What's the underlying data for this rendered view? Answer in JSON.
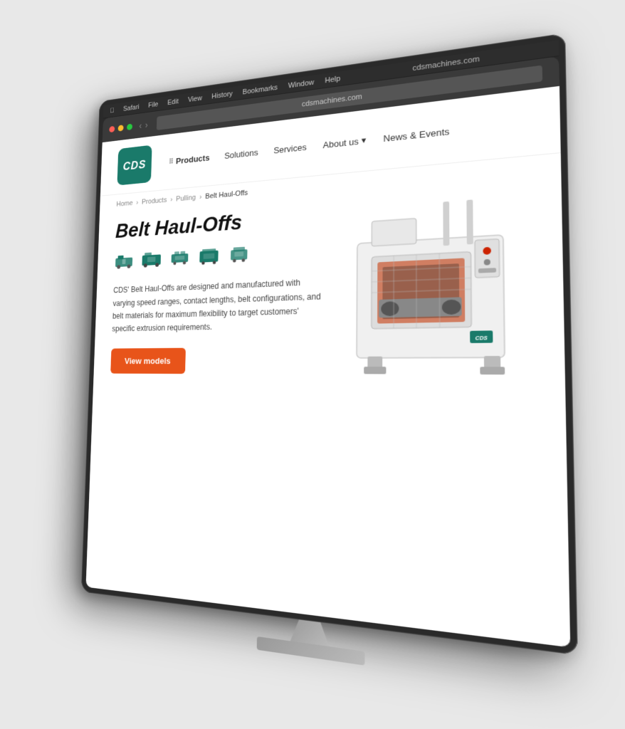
{
  "scene": {
    "background": "#e8e8e8"
  },
  "browser": {
    "url": "cdsmachines.com",
    "menu_items": [
      "Safari",
      "File",
      "Edit",
      "View",
      "History",
      "Bookmarks",
      "Window",
      "Help"
    ]
  },
  "site": {
    "logo_text": "CDS",
    "nav": {
      "items": [
        {
          "label": "Products",
          "icon": "grid",
          "active": true
        },
        {
          "label": "Solutions",
          "active": false
        },
        {
          "label": "Services",
          "active": false
        },
        {
          "label": "About us",
          "has_dropdown": true,
          "active": false
        },
        {
          "label": "News & Events",
          "active": false
        }
      ]
    },
    "breadcrumb": {
      "items": [
        "Home",
        "Products",
        "Pulling",
        "Belt Haul-Offs"
      ]
    },
    "page_title": "Belt Haul-Offs",
    "description": "CDS' Belt Haul-Offs are designed and manufactured with varying speed ranges, contact lengths, belt configurations, and belt materials for maximum flexibility to target customers' specific extrusion requirements.",
    "cta_button": "View models"
  }
}
